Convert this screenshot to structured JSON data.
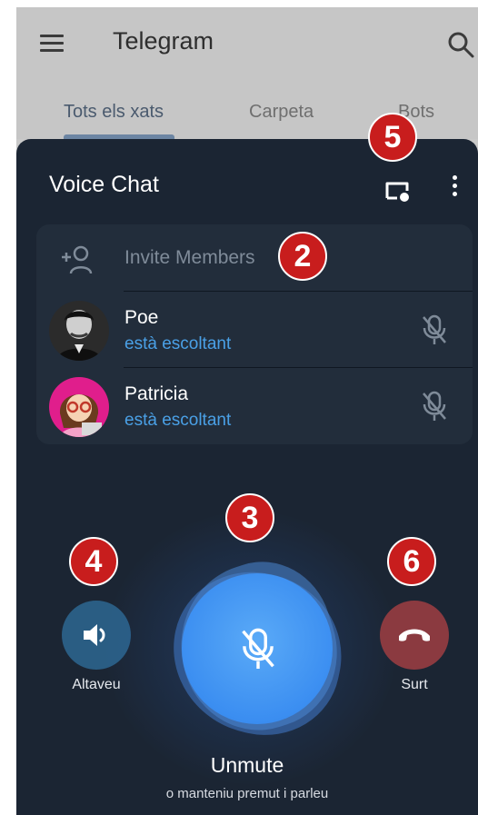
{
  "header": {
    "title": "Telegram",
    "tabs": [
      {
        "label": "Tots els xats",
        "active": true
      },
      {
        "label": "Carpeta",
        "active": false
      },
      {
        "label": "Bots",
        "active": false
      }
    ]
  },
  "voice_chat": {
    "title": "Voice Chat",
    "invite_label": "Invite Members",
    "members": [
      {
        "name": "Poe",
        "status": "està escoltant",
        "muted": true
      },
      {
        "name": "Patricia",
        "status": "està escoltant",
        "muted": true
      }
    ],
    "controls": {
      "speaker_label": "Altaveu",
      "leave_label": "Surt",
      "mic_state": "Unmute",
      "mic_hint": "o manteniu premut i parleu"
    }
  },
  "callouts": [
    "2",
    "3",
    "4",
    "5",
    "6"
  ],
  "colors": {
    "sheet_bg": "#1b2533",
    "panel_bg": "#222d3b",
    "status_blue": "#4aa0e6",
    "mic_blue": "#3b8ef1",
    "speaker_blue": "#2a5d83",
    "leave_red": "#8b3a40",
    "badge_red": "#c81d1d"
  },
  "icons": [
    "menu-icon",
    "search-icon",
    "screen-share-icon",
    "more-vertical-icon",
    "add-user-icon",
    "mic-off-icon",
    "speaker-icon",
    "phone-hangup-icon"
  ]
}
